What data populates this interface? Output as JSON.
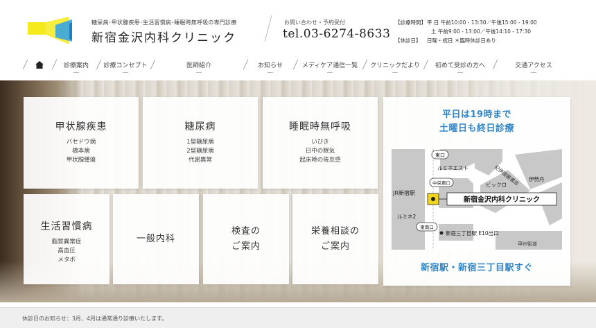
{
  "header": {
    "subtitle": "糖尿病･甲状腺疾患･生活習慣病･睡眠時無呼吸の専門診療",
    "clinic_name": "新宿金沢内科クリニック",
    "contact_label": "お問い合わせ・予約受付",
    "tel": "tel.03-6274-8633",
    "hours": {
      "label": "【診療時間】",
      "row1_days": "平 日",
      "row1_val": "午前10:00 - 13:30／午後15:00 - 19:00",
      "row2_val": "土 午前9:00 - 13:00／午後14:10 - 17:30",
      "closed_label": "【休診日】",
      "closed_val": "日曜・祝日  ＊臨時休診日あり"
    }
  },
  "nav": {
    "home_icon": "home-icon",
    "items": [
      {
        "label": "診療案内",
        "w": 64
      },
      {
        "label": "診療コンセプト",
        "w": 78
      },
      {
        "label": "医師紹介",
        "w": 134
      },
      {
        "label": "お知らせ",
        "w": 72
      },
      {
        "label": "メディケア通信一覧",
        "w": 100
      },
      {
        "label": "クリニックだより",
        "w": 88
      },
      {
        "label": "初めて受診の方へ",
        "w": 100
      },
      {
        "label": "交通アクセス",
        "w": 112
      }
    ]
  },
  "cards": {
    "thyroid": {
      "title": "甲状腺疾患",
      "items": [
        "バセドウ病",
        "橋本病",
        "甲状腺腫瘍"
      ]
    },
    "diabetes": {
      "title": "糖尿病",
      "items": [
        "1型糖尿病",
        "2型糖尿病",
        "代謝異常"
      ]
    },
    "apnea": {
      "title": "睡眠時無呼吸",
      "items": [
        "いびき",
        "日中の眠気",
        "起床時の倦怠感"
      ]
    },
    "lifestyle": {
      "title": "生活習慣病",
      "items": [
        "脂質異常症",
        "高血圧",
        "メタボ"
      ]
    },
    "general": {
      "title": "一般内科"
    },
    "exam": {
      "line1": "検査の",
      "line2": "ご案内"
    },
    "nutrition": {
      "line1": "栄養相談の",
      "line2": "ご案内"
    }
  },
  "map_card": {
    "head1": "平日は19時まで",
    "head2": "土曜日も終日診療",
    "foot": "新宿駅・新宿三丁目駅すぐ",
    "labels": {
      "east_exit": "東口",
      "lumine_est": "ルミネエスト",
      "jr_shinjuku": "JR新宿駅",
      "central_east": "中央東口",
      "lumine2": "ルミネ2",
      "southeast": "東南口",
      "kinokuniya": "紀伊國屋書店",
      "bicqlo": "ビックロ",
      "isetan": "伊勢丹",
      "clinic": "新宿金沢内科クリニック",
      "sanchome": "新宿三丁目駅 E10出口",
      "koshu": "甲州街道"
    }
  },
  "notice": "休診日のお知らせ：3月、4月は通常通り診療いたします。",
  "colors": {
    "accent_blue": "#2f86c9",
    "logo_yellow": "#f4ea1c",
    "logo_blue": "#36a4e0",
    "pin_yellow": "#f1d51d"
  }
}
